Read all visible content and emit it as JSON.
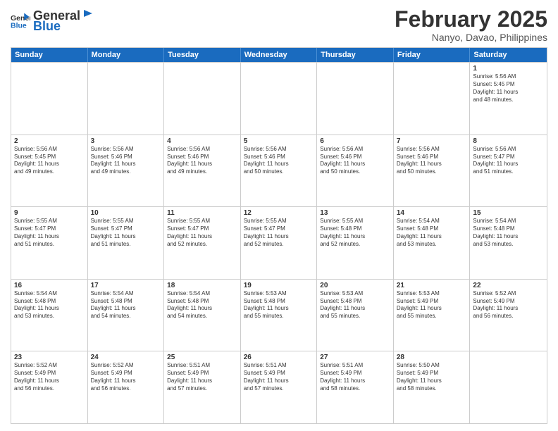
{
  "logo": {
    "general": "General",
    "blue": "Blue"
  },
  "header": {
    "month": "February 2025",
    "location": "Nanyo, Davao, Philippines"
  },
  "weekdays": [
    "Sunday",
    "Monday",
    "Tuesday",
    "Wednesday",
    "Thursday",
    "Friday",
    "Saturday"
  ],
  "rows": [
    [
      {
        "day": "",
        "info": ""
      },
      {
        "day": "",
        "info": ""
      },
      {
        "day": "",
        "info": ""
      },
      {
        "day": "",
        "info": ""
      },
      {
        "day": "",
        "info": ""
      },
      {
        "day": "",
        "info": ""
      },
      {
        "day": "1",
        "info": "Sunrise: 5:56 AM\nSunset: 5:45 PM\nDaylight: 11 hours\nand 48 minutes."
      }
    ],
    [
      {
        "day": "2",
        "info": "Sunrise: 5:56 AM\nSunset: 5:45 PM\nDaylight: 11 hours\nand 49 minutes."
      },
      {
        "day": "3",
        "info": "Sunrise: 5:56 AM\nSunset: 5:46 PM\nDaylight: 11 hours\nand 49 minutes."
      },
      {
        "day": "4",
        "info": "Sunrise: 5:56 AM\nSunset: 5:46 PM\nDaylight: 11 hours\nand 49 minutes."
      },
      {
        "day": "5",
        "info": "Sunrise: 5:56 AM\nSunset: 5:46 PM\nDaylight: 11 hours\nand 50 minutes."
      },
      {
        "day": "6",
        "info": "Sunrise: 5:56 AM\nSunset: 5:46 PM\nDaylight: 11 hours\nand 50 minutes."
      },
      {
        "day": "7",
        "info": "Sunrise: 5:56 AM\nSunset: 5:46 PM\nDaylight: 11 hours\nand 50 minutes."
      },
      {
        "day": "8",
        "info": "Sunrise: 5:56 AM\nSunset: 5:47 PM\nDaylight: 11 hours\nand 51 minutes."
      }
    ],
    [
      {
        "day": "9",
        "info": "Sunrise: 5:55 AM\nSunset: 5:47 PM\nDaylight: 11 hours\nand 51 minutes."
      },
      {
        "day": "10",
        "info": "Sunrise: 5:55 AM\nSunset: 5:47 PM\nDaylight: 11 hours\nand 51 minutes."
      },
      {
        "day": "11",
        "info": "Sunrise: 5:55 AM\nSunset: 5:47 PM\nDaylight: 11 hours\nand 52 minutes."
      },
      {
        "day": "12",
        "info": "Sunrise: 5:55 AM\nSunset: 5:47 PM\nDaylight: 11 hours\nand 52 minutes."
      },
      {
        "day": "13",
        "info": "Sunrise: 5:55 AM\nSunset: 5:48 PM\nDaylight: 11 hours\nand 52 minutes."
      },
      {
        "day": "14",
        "info": "Sunrise: 5:54 AM\nSunset: 5:48 PM\nDaylight: 11 hours\nand 53 minutes."
      },
      {
        "day": "15",
        "info": "Sunrise: 5:54 AM\nSunset: 5:48 PM\nDaylight: 11 hours\nand 53 minutes."
      }
    ],
    [
      {
        "day": "16",
        "info": "Sunrise: 5:54 AM\nSunset: 5:48 PM\nDaylight: 11 hours\nand 53 minutes."
      },
      {
        "day": "17",
        "info": "Sunrise: 5:54 AM\nSunset: 5:48 PM\nDaylight: 11 hours\nand 54 minutes."
      },
      {
        "day": "18",
        "info": "Sunrise: 5:54 AM\nSunset: 5:48 PM\nDaylight: 11 hours\nand 54 minutes."
      },
      {
        "day": "19",
        "info": "Sunrise: 5:53 AM\nSunset: 5:48 PM\nDaylight: 11 hours\nand 55 minutes."
      },
      {
        "day": "20",
        "info": "Sunrise: 5:53 AM\nSunset: 5:48 PM\nDaylight: 11 hours\nand 55 minutes."
      },
      {
        "day": "21",
        "info": "Sunrise: 5:53 AM\nSunset: 5:49 PM\nDaylight: 11 hours\nand 55 minutes."
      },
      {
        "day": "22",
        "info": "Sunrise: 5:52 AM\nSunset: 5:49 PM\nDaylight: 11 hours\nand 56 minutes."
      }
    ],
    [
      {
        "day": "23",
        "info": "Sunrise: 5:52 AM\nSunset: 5:49 PM\nDaylight: 11 hours\nand 56 minutes."
      },
      {
        "day": "24",
        "info": "Sunrise: 5:52 AM\nSunset: 5:49 PM\nDaylight: 11 hours\nand 56 minutes."
      },
      {
        "day": "25",
        "info": "Sunrise: 5:51 AM\nSunset: 5:49 PM\nDaylight: 11 hours\nand 57 minutes."
      },
      {
        "day": "26",
        "info": "Sunrise: 5:51 AM\nSunset: 5:49 PM\nDaylight: 11 hours\nand 57 minutes."
      },
      {
        "day": "27",
        "info": "Sunrise: 5:51 AM\nSunset: 5:49 PM\nDaylight: 11 hours\nand 58 minutes."
      },
      {
        "day": "28",
        "info": "Sunrise: 5:50 AM\nSunset: 5:49 PM\nDaylight: 11 hours\nand 58 minutes."
      },
      {
        "day": "",
        "info": ""
      }
    ]
  ]
}
